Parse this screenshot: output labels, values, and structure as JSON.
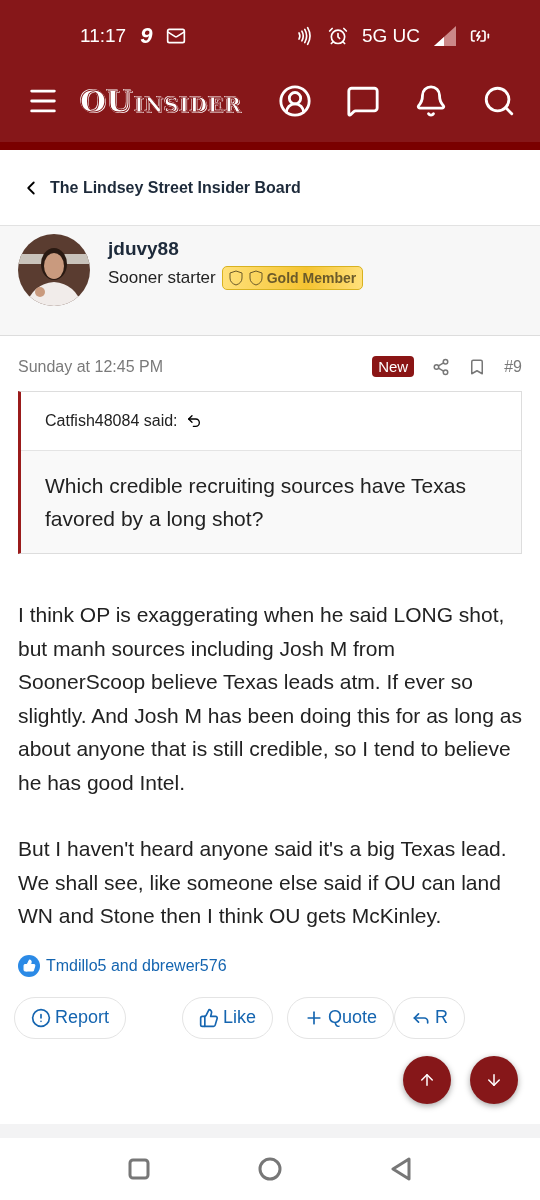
{
  "status_bar": {
    "time": "11:17",
    "notification_glyph": "9",
    "network": "5G UC"
  },
  "header": {
    "logo_left": "OU",
    "logo_right": "INSIDER"
  },
  "breadcrumb": {
    "label": "The Lindsey Street Insider Board"
  },
  "author": {
    "name": "jduvy88",
    "title": "Sooner starter",
    "badge": "Gold Member"
  },
  "post": {
    "date": "Sunday at 12:45 PM",
    "new_label": "New",
    "number": "#9",
    "quote": {
      "author": "Catfish48084 said:",
      "text": "Which credible recruiting sources have Texas favored by a long shot?"
    },
    "paragraphs": [
      "I think OP is exaggerating when he said LONG shot, but manh sources including Josh M from SoonerScoop believe Texas leads atm. If ever so slightly. And Josh M has been doing this for as long as about anyone that is still credible, so I tend to believe he has good Intel.",
      "But I haven't heard anyone said it's a big Texas lead. We shall see, like someone else said if OU can land WN and Stone then I think OU gets McKinley."
    ],
    "reactions": "Tmdillo5 and dbrewer576",
    "actions": [
      {
        "kind": "report",
        "label": "Report"
      },
      {
        "kind": "like",
        "label": "Like"
      },
      {
        "kind": "quote",
        "label": "Quote"
      },
      {
        "kind": "reply",
        "label": "R"
      }
    ]
  }
}
